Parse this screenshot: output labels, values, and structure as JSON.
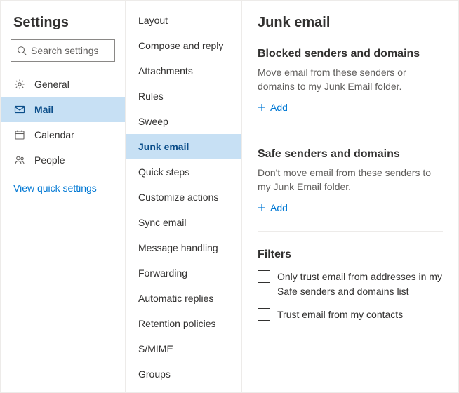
{
  "settings": {
    "title": "Settings",
    "search_placeholder": "Search settings",
    "nav": {
      "general": "General",
      "mail": "Mail",
      "calendar": "Calendar",
      "people": "People"
    },
    "quick_link": "View quick settings"
  },
  "mail_nav": {
    "layout": "Layout",
    "compose": "Compose and reply",
    "attachments": "Attachments",
    "rules": "Rules",
    "sweep": "Sweep",
    "junk": "Junk email",
    "quicksteps": "Quick steps",
    "customize": "Customize actions",
    "sync": "Sync email",
    "msghandling": "Message handling",
    "forwarding": "Forwarding",
    "autoreply": "Automatic replies",
    "retention": "Retention policies",
    "smime": "S/MIME",
    "groups": "Groups"
  },
  "junk": {
    "title": "Junk email",
    "blocked": {
      "title": "Blocked senders and domains",
      "desc": "Move email from these senders or domains to my Junk Email folder.",
      "add": "Add"
    },
    "safe": {
      "title": "Safe senders and domains",
      "desc": "Don't move email from these senders to my Junk Email folder.",
      "add": "Add"
    },
    "filters": {
      "title": "Filters",
      "opt1": "Only trust email from addresses in my Safe senders and domains list",
      "opt2": "Trust email from my contacts"
    }
  }
}
